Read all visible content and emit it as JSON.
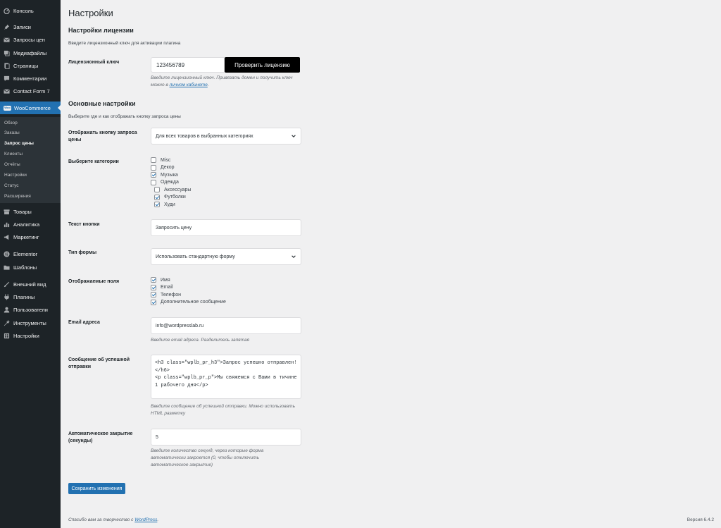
{
  "sidebar": {
    "items": [
      {
        "label": "Консоль",
        "icon": "dashboard-icon"
      },
      {
        "label": "Записи",
        "icon": "pin-icon"
      },
      {
        "label": "Запросы цен",
        "icon": "mail-icon"
      },
      {
        "label": "Медиафайлы",
        "icon": "media-icon"
      },
      {
        "label": "Страницы",
        "icon": "pages-icon"
      },
      {
        "label": "Комментарии",
        "icon": "comment-icon"
      },
      {
        "label": "Contact Form 7",
        "icon": "mail-icon"
      },
      {
        "label": "WooCommerce",
        "icon": "woo-icon",
        "badge": "Woo"
      },
      {
        "label": "Товары",
        "icon": "products-icon"
      },
      {
        "label": "Аналитика",
        "icon": "chart-icon"
      },
      {
        "label": "Маркетинг",
        "icon": "megaphone-icon"
      },
      {
        "label": "Elementor",
        "icon": "elementor-icon"
      },
      {
        "label": "Шаблоны",
        "icon": "folder-icon"
      },
      {
        "label": "Внешний вид",
        "icon": "brush-icon"
      },
      {
        "label": "Плагины",
        "icon": "plugin-icon"
      },
      {
        "label": "Пользователи",
        "icon": "user-icon"
      },
      {
        "label": "Инструменты",
        "icon": "wrench-icon"
      },
      {
        "label": "Настройки",
        "icon": "settings-icon"
      }
    ],
    "submenu": [
      "Обзор",
      "Заказы",
      "Запрос цены",
      "Клиенты",
      "Отчёты",
      "Настройки",
      "Статус",
      "Расширения"
    ]
  },
  "page": {
    "title": "Настройки",
    "license": {
      "heading": "Настройки лицензии",
      "description": "Введите лицензионный ключ для активации плагина",
      "key_label": "Лицензионный ключ",
      "key_value": "123456789",
      "check_button": "Проверить лицензию",
      "help_1": "Введите лицензионный ключ. Привязать домен и получить ключ",
      "help_2": "можно в",
      "help_link": "личном кабинете",
      "help_end": "."
    },
    "main": {
      "heading": "Основные настройки",
      "description": "Выберите где и как отображать кнопку запроса цены",
      "display_label": "Отображать кнопку запроса цены",
      "display_value": "Для всех товаров в выбранных категориях",
      "categories_label": "Выберите категории",
      "categories": [
        {
          "label": "Misc",
          "checked": false,
          "indent": false
        },
        {
          "label": "Декор",
          "checked": false,
          "indent": false
        },
        {
          "label": "Музыка",
          "checked": true,
          "indent": false
        },
        {
          "label": "Одежда",
          "checked": false,
          "indent": false
        },
        {
          "label": "Аксессуары",
          "checked": false,
          "indent": true
        },
        {
          "label": "Футболки",
          "checked": true,
          "indent": true
        },
        {
          "label": "Худи",
          "checked": true,
          "indent": true
        }
      ],
      "button_text_label": "Текст кнопки",
      "button_text_value": "Запросить цену",
      "form_type_label": "Тип формы",
      "form_type_value": "Использовать стандартную форму",
      "fields_label": "Отображаемые поля",
      "fields": [
        {
          "label": "Имя",
          "checked": true
        },
        {
          "label": "Email",
          "checked": true
        },
        {
          "label": "Телефон",
          "checked": true
        },
        {
          "label": "Дополнительное сообщение",
          "checked": true
        }
      ],
      "email_label": "Email адреса",
      "email_value": "info@wordpresslab.ru",
      "email_help": "Введите email адреса. Разделитель запятая",
      "success_label": "Сообщение об успешной отправки",
      "success_value": "<h3 class=\"wplb_pr_h3\">Запрос успешно отправлен!</h6>\n<p class=\"wplb_pr_p\">Мы свяжемся с Вами в тичине 1 рабочего дня</p>",
      "success_help_1": "Введите сообщение об успешной отправки. Можно использовать",
      "success_help_2": "HTML разметку",
      "autoclose_label": "Автоматическое закрытие (секунды)",
      "autoclose_value": "5",
      "autoclose_help_1": "Введите количество секунд, через которые форма",
      "autoclose_help_2": "автоматически закроется (0, чтобы отключить",
      "autoclose_help_3": "автоматическое закрытие)",
      "save_button": "Сохранить изменения"
    }
  },
  "footer": {
    "thanks_prefix": "Спасибо вам за творчество с",
    "thanks_link": "WordPress",
    "thanks_suffix": ".",
    "version": "Версия 6.4.2"
  },
  "colors": {
    "sidebar_bg": "#1d2327",
    "accent": "#2271b1",
    "background": "#f0f0f1"
  }
}
